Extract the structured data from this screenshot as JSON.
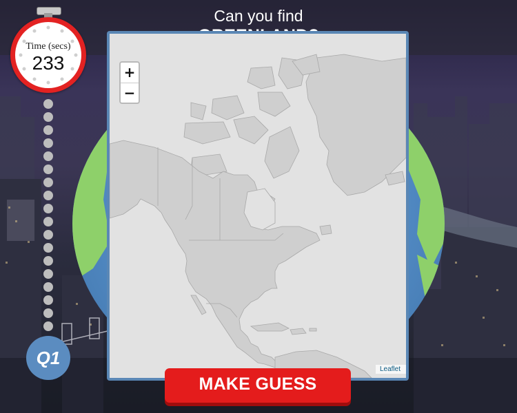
{
  "question": {
    "prompt": "Can you find",
    "target": "GREENLAND?"
  },
  "timer": {
    "label": "Time (secs)",
    "value": "233"
  },
  "progress": {
    "total_dots": 18
  },
  "question_badge": {
    "label": "Q1"
  },
  "map": {
    "zoom_in_label": "+",
    "zoom_out_label": "−",
    "attribution": "Leaflet",
    "land_color": "#cfcfcf",
    "water_color": "#e2e2e2"
  },
  "action": {
    "make_guess_label": "MAKE GUESS"
  },
  "colors": {
    "accent_red": "#e41c1c",
    "badge_blue": "#5b8cc0",
    "globe_land": "#8ed06a",
    "globe_water": "#4f87c0"
  }
}
